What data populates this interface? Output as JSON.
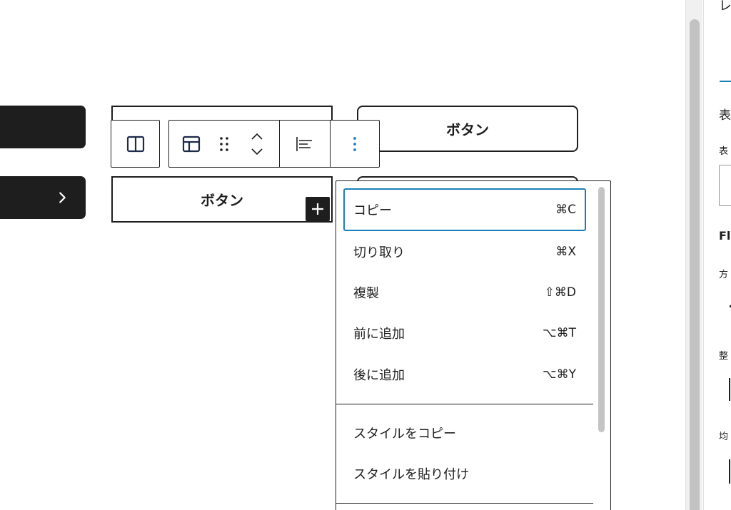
{
  "canvas": {
    "buttons": [
      {
        "label": ""
      },
      {
        "label": "ボタン"
      },
      {
        "label": "ボタン"
      },
      {
        "label": ""
      }
    ]
  },
  "toolbar": {
    "parent_icon": "columns-icon",
    "block_icon": "layout-icon",
    "drag_icon": "drag-handle-icon",
    "move_icon": "chevron-up-down-icon",
    "align_icon": "justify-left-icon",
    "more_icon": "more-vertical-icon"
  },
  "menu": {
    "group1": [
      {
        "label": "コピー",
        "shortcut": "⌘C"
      },
      {
        "label": "切り取り",
        "shortcut": "⌘X"
      },
      {
        "label": "複製",
        "shortcut": "⇧⌘D"
      },
      {
        "label": "前に追加",
        "shortcut": "⌥⌘T"
      },
      {
        "label": "後に追加",
        "shortcut": "⌥⌘Y"
      }
    ],
    "group2": [
      {
        "label": "スタイルをコピー"
      },
      {
        "label": "スタイルを貼り付け"
      }
    ]
  },
  "sidebar": {
    "tab_fragment": "レ",
    "section_title": "表",
    "label_1": "表",
    "flex_title": "Fl",
    "direction_label": "方",
    "align_label": "整",
    "spacing_label": "均"
  },
  "colors": {
    "dark": "#1e1e1e",
    "accent": "#1b7fb8",
    "scrollbar": "#c2c2c2"
  }
}
